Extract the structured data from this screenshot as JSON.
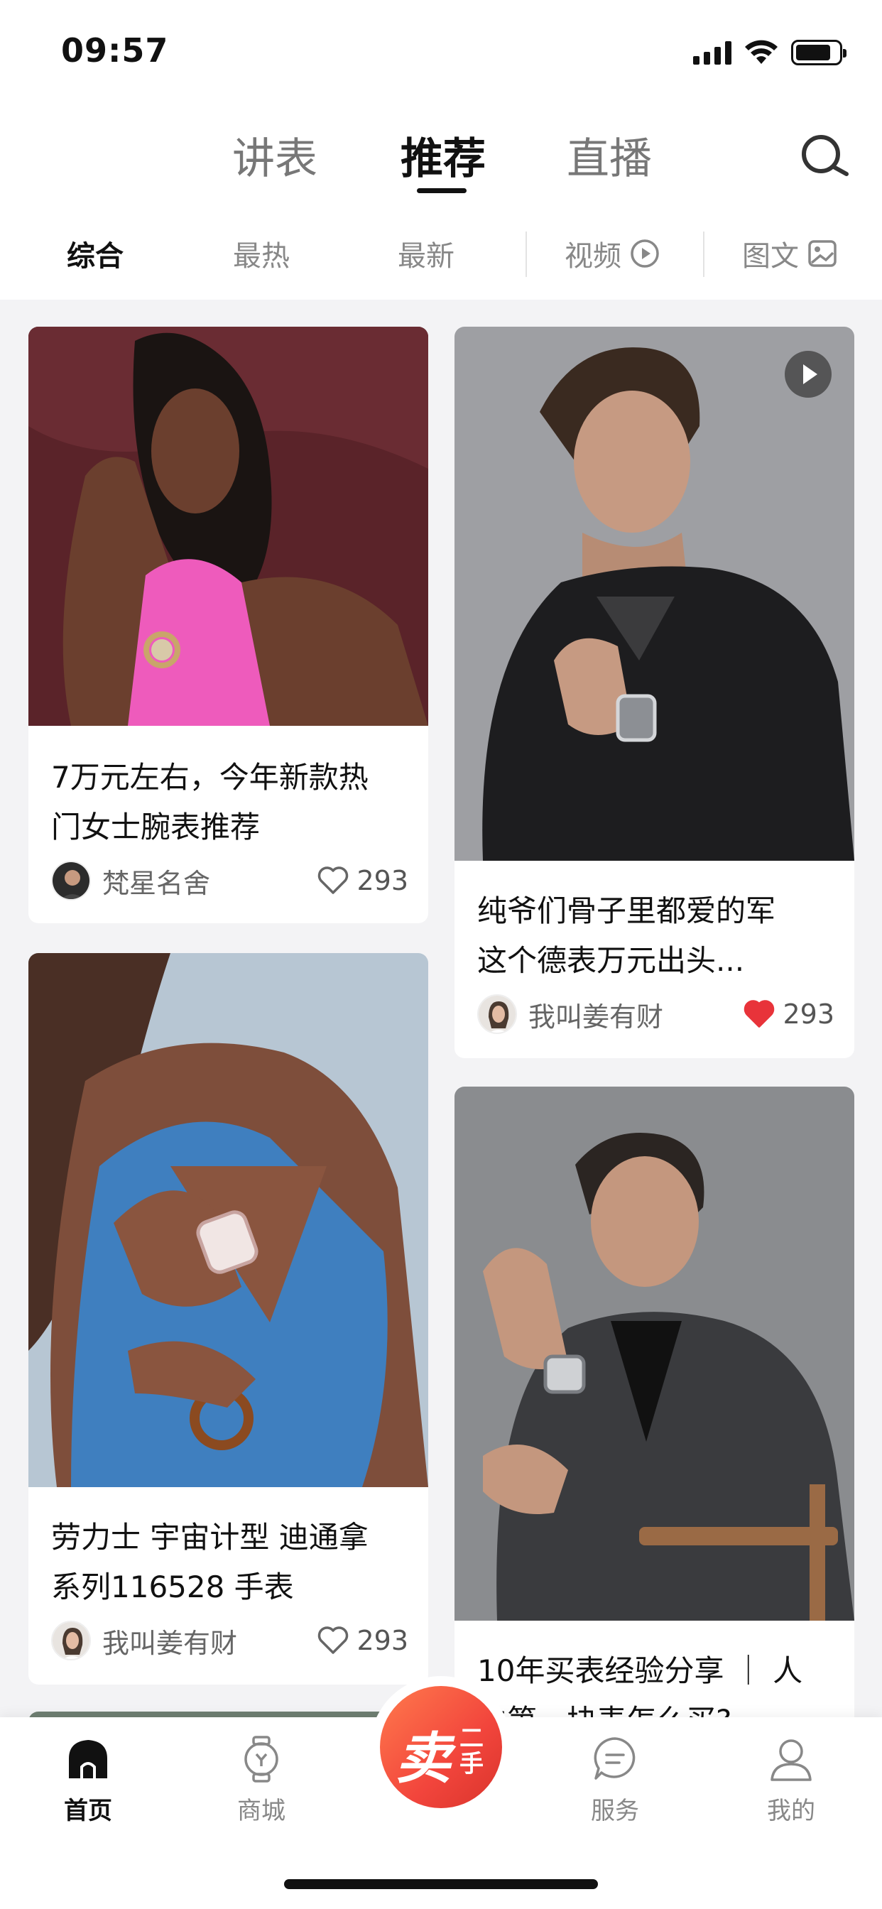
{
  "status_bar": {
    "time": "09:57"
  },
  "top_tabs": [
    {
      "label": "讲表"
    },
    {
      "label": "推荐"
    },
    {
      "label": "直播"
    }
  ],
  "sub_tabs": [
    {
      "label": "综合"
    },
    {
      "label": "最热"
    },
    {
      "label": "最新"
    },
    {
      "label": "视频"
    },
    {
      "label": "图文"
    }
  ],
  "cards": [
    {
      "title_line1": "7万元左右，今年新款热",
      "title_line2": "门女士腕表推荐",
      "author": "梵星名舍",
      "likes": "293",
      "liked": false,
      "has_video": false
    },
    {
      "title_line1": "纯爷们骨子里都爱的军",
      "title_line2": "这个德表万元出头...",
      "author": "我叫姜有财",
      "likes": "293",
      "liked": true,
      "has_video": true
    },
    {
      "title_line1": "劳力士 宇宙计型 迪通拿",
      "title_line2": "系列116528 手表",
      "author": "我叫姜有财",
      "likes": "293",
      "liked": false,
      "has_video": false
    },
    {
      "title_line1": "10年买表经验分享 ｜ 人",
      "title_line2": "生第一块表怎么买?",
      "author": "",
      "likes": "",
      "liked": false,
      "has_video": false
    }
  ],
  "bottom_nav": [
    {
      "label": "首页"
    },
    {
      "label": "商城"
    },
    {
      "label": "服务"
    },
    {
      "label": "我的"
    }
  ],
  "sell_button": {
    "main": "卖",
    "sub": "二手"
  },
  "colors": {
    "accent": "#f2453c",
    "like_active": "#e8333a",
    "feed_bg": "#f3f3f5"
  }
}
